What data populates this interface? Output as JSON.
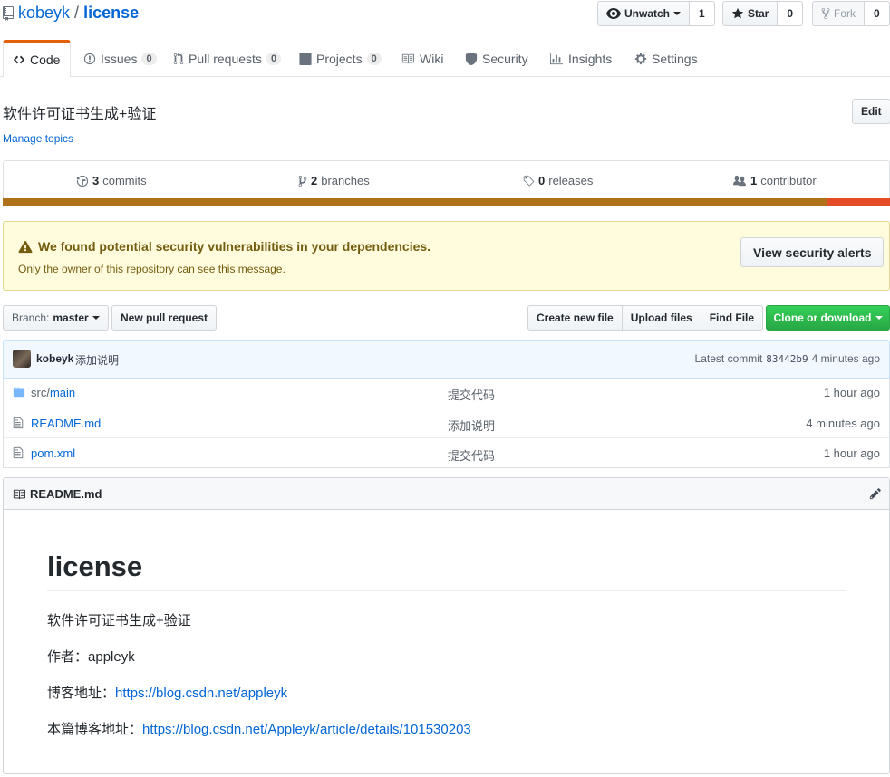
{
  "repo": {
    "owner": "kobeyk",
    "separator": "/",
    "name": "license"
  },
  "actions": {
    "watch_label": "Unwatch",
    "watch_count": "1",
    "star_label": "Star",
    "star_count": "0",
    "fork_label": "Fork",
    "fork_count": "0"
  },
  "tabs": [
    {
      "label": "Code",
      "icon": "code-icon"
    },
    {
      "label": "Issues",
      "count": "0",
      "icon": "issue-icon"
    },
    {
      "label": "Pull requests",
      "count": "0",
      "icon": "pull-request-icon"
    },
    {
      "label": "Projects",
      "count": "0",
      "icon": "project-icon"
    },
    {
      "label": "Wiki",
      "icon": "book-icon"
    },
    {
      "label": "Security",
      "icon": "shield-icon"
    },
    {
      "label": "Insights",
      "icon": "graph-icon"
    },
    {
      "label": "Settings",
      "icon": "gear-icon"
    }
  ],
  "description": "软件许可证书生成+验证",
  "manage_topics": "Manage topics",
  "edit_label": "Edit",
  "summary": {
    "commits_num": "3",
    "commits_label": "commits",
    "branches_num": "2",
    "branches_label": "branches",
    "releases_num": "0",
    "releases_label": "releases",
    "contributors_num": "1",
    "contributors_label": "contributor"
  },
  "languages": [
    {
      "color": "#b07219",
      "percent": 93
    },
    {
      "color": "#e34c26",
      "percent": 7
    }
  ],
  "alert": {
    "title": "We found potential security vulnerabilities in your dependencies.",
    "subtitle": "Only the owner of this repository can see this message.",
    "button": "View security alerts"
  },
  "file_nav": {
    "branch_prefix": "Branch:",
    "branch_name": "master",
    "new_pr": "New pull request",
    "create_file": "Create new file",
    "upload_files": "Upload files",
    "find_file": "Find File",
    "clone": "Clone or download"
  },
  "commit": {
    "author": "kobeyk",
    "message": "添加说明",
    "latest_label": "Latest commit",
    "sha": "83442b9",
    "age": "4 minutes ago"
  },
  "files": [
    {
      "dir": "src/",
      "name": "main",
      "type": "folder",
      "message": "提交代码",
      "age": "1 hour ago"
    },
    {
      "dir": "",
      "name": "README.md",
      "type": "file",
      "message": "添加说明",
      "age": "4 minutes ago"
    },
    {
      "dir": "",
      "name": "pom.xml",
      "type": "file",
      "message": "提交代码",
      "age": "1 hour ago"
    }
  ],
  "readme": {
    "filename": "README.md",
    "heading": "license",
    "line1": "软件许可证书生成+验证",
    "author_label": "作者：",
    "author": "appleyk",
    "blog_label": "博客地址：",
    "blog_url": "https://blog.csdn.net/appleyk",
    "post_label": "本篇博客地址：",
    "post_url": "https://blog.csdn.net/Appleyk/article/details/101530203"
  }
}
